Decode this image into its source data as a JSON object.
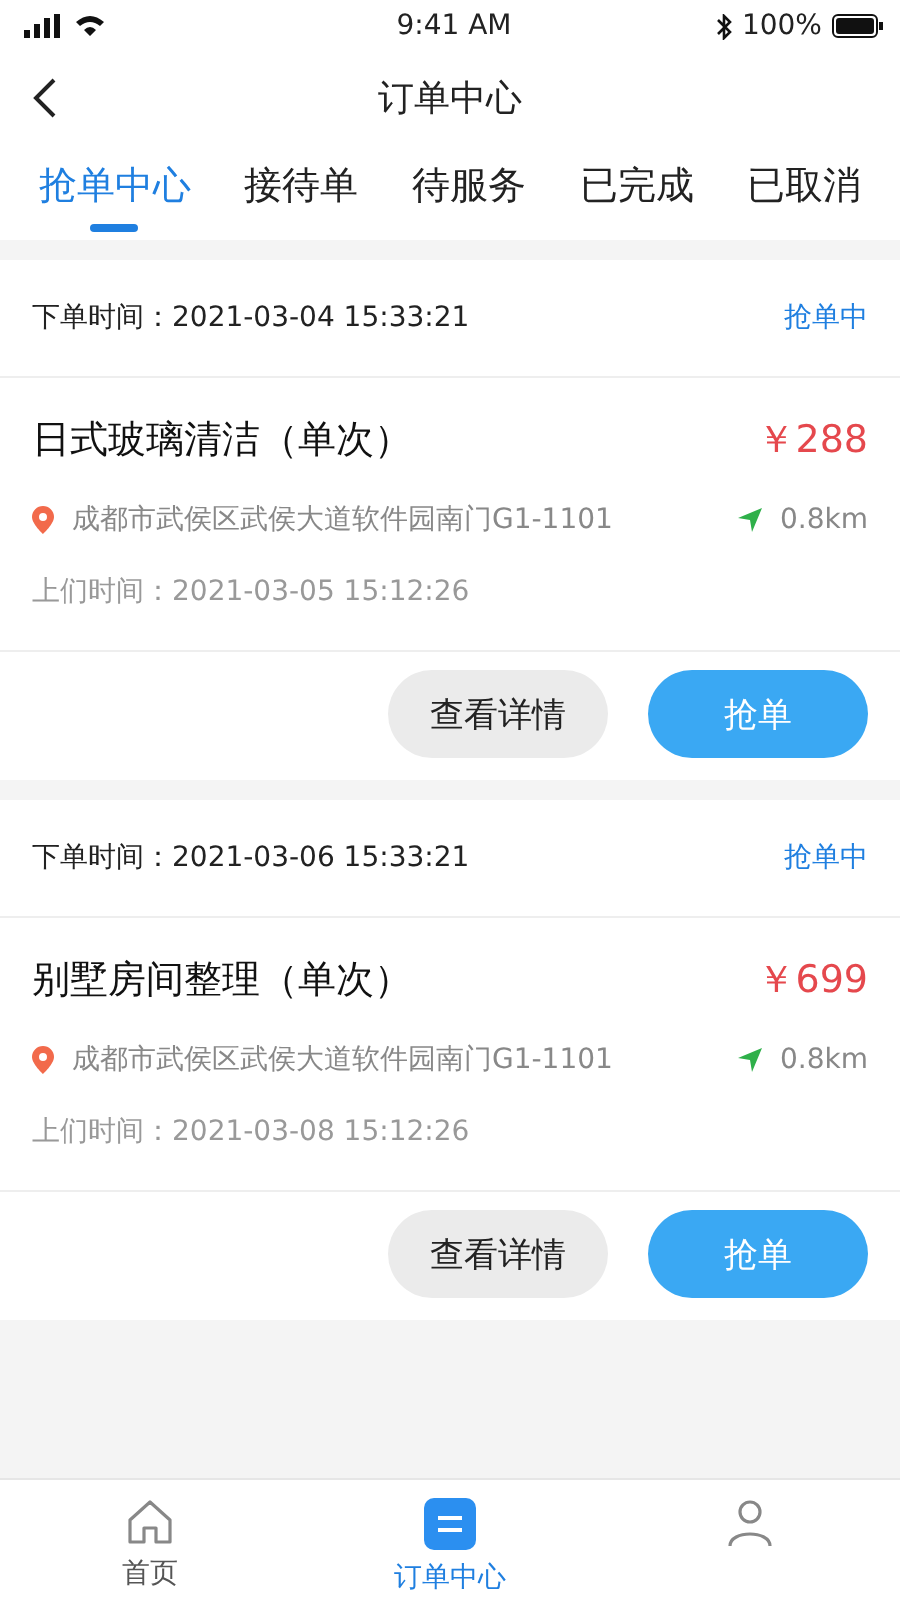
{
  "status_bar": {
    "time": "9:41 AM",
    "battery": "100%"
  },
  "header": {
    "title": "订单中心"
  },
  "tabs": [
    {
      "label": "抢单中心",
      "selected": true
    },
    {
      "label": "接待单",
      "selected": false
    },
    {
      "label": "待服务",
      "selected": false
    },
    {
      "label": "已完成",
      "selected": false
    },
    {
      "label": "已取消",
      "selected": false
    }
  ],
  "orders": [
    {
      "order_time": "下单时间：2021-03-04 15:33:21",
      "status": "抢单中",
      "title": "日式玻璃清洁（单次）",
      "price": "￥288",
      "address": "成都市武侯区武侯大道软件园南门G1-1101",
      "distance": "0.8km",
      "visit_time": "上们时间：2021-03-05 15:12:26",
      "buttons": [
        {
          "label": "查看详情",
          "kind": "secondary"
        },
        {
          "label": "抢单",
          "kind": "primary"
        }
      ]
    },
    {
      "order_time": "下单时间：2021-03-06 15:33:21",
      "status": "抢单中",
      "title": "别墅房间整理（单次）",
      "price": "￥699",
      "address": "成都市武侯区武侯大道软件园南门G1-1101",
      "distance": "0.8km",
      "visit_time": "上们时间：2021-03-08 15:12:26",
      "buttons": [
        {
          "label": "查看详情",
          "kind": "secondary"
        },
        {
          "label": "抢单",
          "kind": "primary"
        }
      ]
    }
  ],
  "bottom_nav": [
    {
      "label": "首页",
      "kind": "home",
      "selected": false
    },
    {
      "label": "订单中心",
      "kind": "orders",
      "selected": true
    },
    {
      "kind": "person",
      "selected": false
    }
  ]
}
